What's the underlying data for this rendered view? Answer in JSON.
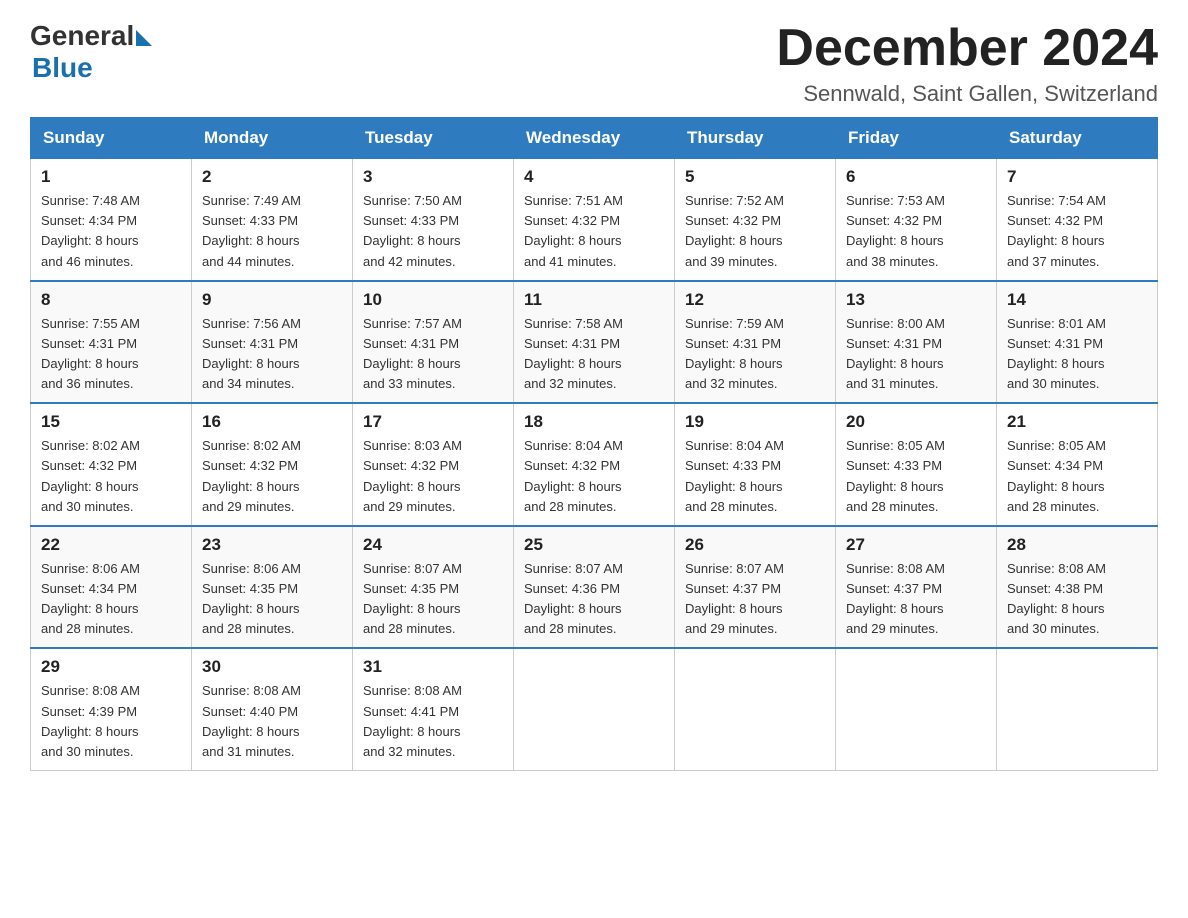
{
  "header": {
    "logo_general": "General",
    "logo_blue": "Blue",
    "month_year": "December 2024",
    "location": "Sennwald, Saint Gallen, Switzerland"
  },
  "weekdays": [
    "Sunday",
    "Monday",
    "Tuesday",
    "Wednesday",
    "Thursday",
    "Friday",
    "Saturday"
  ],
  "rows": [
    [
      {
        "day": "1",
        "sunrise": "7:48 AM",
        "sunset": "4:34 PM",
        "daylight": "8 hours and 46 minutes."
      },
      {
        "day": "2",
        "sunrise": "7:49 AM",
        "sunset": "4:33 PM",
        "daylight": "8 hours and 44 minutes."
      },
      {
        "day": "3",
        "sunrise": "7:50 AM",
        "sunset": "4:33 PM",
        "daylight": "8 hours and 42 minutes."
      },
      {
        "day": "4",
        "sunrise": "7:51 AM",
        "sunset": "4:32 PM",
        "daylight": "8 hours and 41 minutes."
      },
      {
        "day": "5",
        "sunrise": "7:52 AM",
        "sunset": "4:32 PM",
        "daylight": "8 hours and 39 minutes."
      },
      {
        "day": "6",
        "sunrise": "7:53 AM",
        "sunset": "4:32 PM",
        "daylight": "8 hours and 38 minutes."
      },
      {
        "day": "7",
        "sunrise": "7:54 AM",
        "sunset": "4:32 PM",
        "daylight": "8 hours and 37 minutes."
      }
    ],
    [
      {
        "day": "8",
        "sunrise": "7:55 AM",
        "sunset": "4:31 PM",
        "daylight": "8 hours and 36 minutes."
      },
      {
        "day": "9",
        "sunrise": "7:56 AM",
        "sunset": "4:31 PM",
        "daylight": "8 hours and 34 minutes."
      },
      {
        "day": "10",
        "sunrise": "7:57 AM",
        "sunset": "4:31 PM",
        "daylight": "8 hours and 33 minutes."
      },
      {
        "day": "11",
        "sunrise": "7:58 AM",
        "sunset": "4:31 PM",
        "daylight": "8 hours and 32 minutes."
      },
      {
        "day": "12",
        "sunrise": "7:59 AM",
        "sunset": "4:31 PM",
        "daylight": "8 hours and 32 minutes."
      },
      {
        "day": "13",
        "sunrise": "8:00 AM",
        "sunset": "4:31 PM",
        "daylight": "8 hours and 31 minutes."
      },
      {
        "day": "14",
        "sunrise": "8:01 AM",
        "sunset": "4:31 PM",
        "daylight": "8 hours and 30 minutes."
      }
    ],
    [
      {
        "day": "15",
        "sunrise": "8:02 AM",
        "sunset": "4:32 PM",
        "daylight": "8 hours and 30 minutes."
      },
      {
        "day": "16",
        "sunrise": "8:02 AM",
        "sunset": "4:32 PM",
        "daylight": "8 hours and 29 minutes."
      },
      {
        "day": "17",
        "sunrise": "8:03 AM",
        "sunset": "4:32 PM",
        "daylight": "8 hours and 29 minutes."
      },
      {
        "day": "18",
        "sunrise": "8:04 AM",
        "sunset": "4:32 PM",
        "daylight": "8 hours and 28 minutes."
      },
      {
        "day": "19",
        "sunrise": "8:04 AM",
        "sunset": "4:33 PM",
        "daylight": "8 hours and 28 minutes."
      },
      {
        "day": "20",
        "sunrise": "8:05 AM",
        "sunset": "4:33 PM",
        "daylight": "8 hours and 28 minutes."
      },
      {
        "day": "21",
        "sunrise": "8:05 AM",
        "sunset": "4:34 PM",
        "daylight": "8 hours and 28 minutes."
      }
    ],
    [
      {
        "day": "22",
        "sunrise": "8:06 AM",
        "sunset": "4:34 PM",
        "daylight": "8 hours and 28 minutes."
      },
      {
        "day": "23",
        "sunrise": "8:06 AM",
        "sunset": "4:35 PM",
        "daylight": "8 hours and 28 minutes."
      },
      {
        "day": "24",
        "sunrise": "8:07 AM",
        "sunset": "4:35 PM",
        "daylight": "8 hours and 28 minutes."
      },
      {
        "day": "25",
        "sunrise": "8:07 AM",
        "sunset": "4:36 PM",
        "daylight": "8 hours and 28 minutes."
      },
      {
        "day": "26",
        "sunrise": "8:07 AM",
        "sunset": "4:37 PM",
        "daylight": "8 hours and 29 minutes."
      },
      {
        "day": "27",
        "sunrise": "8:08 AM",
        "sunset": "4:37 PM",
        "daylight": "8 hours and 29 minutes."
      },
      {
        "day": "28",
        "sunrise": "8:08 AM",
        "sunset": "4:38 PM",
        "daylight": "8 hours and 30 minutes."
      }
    ],
    [
      {
        "day": "29",
        "sunrise": "8:08 AM",
        "sunset": "4:39 PM",
        "daylight": "8 hours and 30 minutes."
      },
      {
        "day": "30",
        "sunrise": "8:08 AM",
        "sunset": "4:40 PM",
        "daylight": "8 hours and 31 minutes."
      },
      {
        "day": "31",
        "sunrise": "8:08 AM",
        "sunset": "4:41 PM",
        "daylight": "8 hours and 32 minutes."
      },
      null,
      null,
      null,
      null
    ]
  ],
  "labels": {
    "sunrise": "Sunrise:",
    "sunset": "Sunset:",
    "daylight": "Daylight:"
  }
}
